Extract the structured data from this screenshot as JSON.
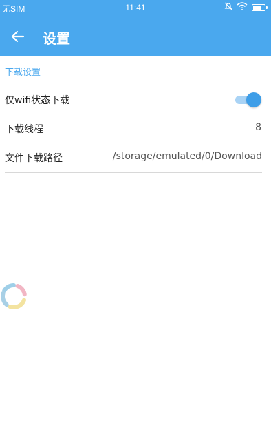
{
  "status_bar": {
    "carrier": "无SIM",
    "time": "11:41",
    "icons": [
      "alarm-off-icon",
      "wifi-icon",
      "battery-charging-icon"
    ],
    "battery_level": 0.7
  },
  "app_bar": {
    "back_icon": "arrow-left-icon",
    "title": "设置",
    "color": "#4aa8ee"
  },
  "settings": {
    "section_title": "下载设置",
    "wifi_only": {
      "label": "仅wifi状态下载",
      "enabled": true
    },
    "threads": {
      "label": "下载线程",
      "value": "8"
    },
    "path": {
      "label": "文件下载路径",
      "value": "/storage/emulated/0/Download"
    }
  },
  "loading_indicator": {
    "icon": "loading-spinner-icon",
    "colors": [
      "#9fcfe8",
      "#f2b6c4",
      "#f3e3a0",
      "#a8d0e6"
    ]
  }
}
